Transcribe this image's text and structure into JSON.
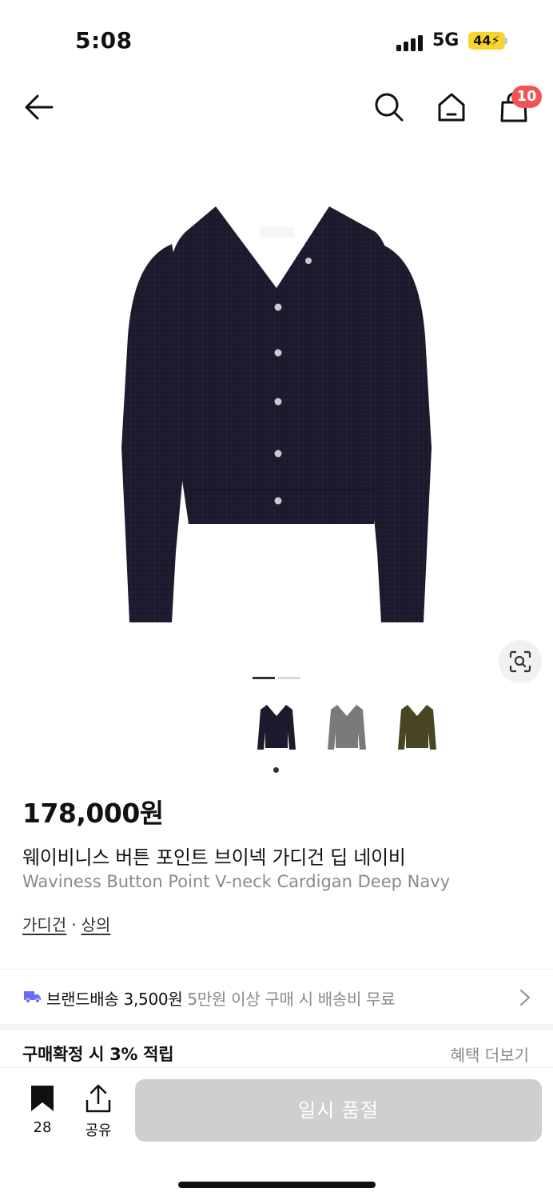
{
  "status_bar": {
    "time": "5:08",
    "network": "5G",
    "battery": "44"
  },
  "nav": {
    "cart_count": "10",
    "icons": [
      "back-arrow-icon",
      "search-icon",
      "home-icon",
      "shopping-bag-icon"
    ]
  },
  "product": {
    "image_count": 2,
    "current_image_index": 0,
    "price": "178,000원",
    "name_ko": "웨이비니스 버튼 포인트 브이넥 가디건 딥 네이비",
    "name_en": "Waviness Button Point V-neck Cardigan Deep Navy",
    "categories": [
      "가디건",
      "상의"
    ],
    "category_separator": "·",
    "color_options": [
      {
        "color": "#1c1b2e",
        "selected": true
      },
      {
        "color": "#7a7a7a",
        "selected": false
      },
      {
        "color": "#4a4522",
        "selected": false
      }
    ]
  },
  "shipping": {
    "label": "브랜드배송 3,500원",
    "note": "5만원 이상 구매 시 배송비 무료",
    "icon_color": "#6b6ef5"
  },
  "reward": {
    "title": "구매확정 시 3% 적립",
    "more": "혜택 더보기"
  },
  "bottom_bar": {
    "bookmark_count": "28",
    "share_label": "공유",
    "primary_button": "일시 품절"
  },
  "colors": {
    "badge": "#f05454",
    "battery": "#f9d42c",
    "disabled_button": "#cfcfcf",
    "muted_text": "#8a8a8a"
  }
}
